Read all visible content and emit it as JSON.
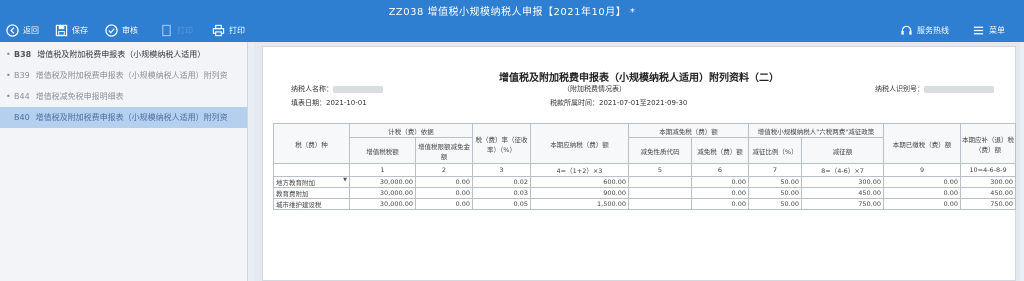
{
  "window": {
    "title": "ZZ038 增值税小规模纳税人申报【2021年10月】 *"
  },
  "toolbar": {
    "back_label": "返回",
    "save_label": "保存",
    "review_label": "审核",
    "disabled_label": "打印",
    "print_label": "打印",
    "hotline_label": "服务热线",
    "menu_label": "菜单"
  },
  "sidebar": {
    "items": [
      {
        "code": "B38",
        "label": "增值税及附加税费申报表（小规模纳税人适用）"
      },
      {
        "code": "B39",
        "label": "增值税及附加税费申报表（小规模纳税人适用）附列资"
      },
      {
        "code": "B44",
        "label": "增值税减免税申报明细表"
      },
      {
        "code": "B40",
        "label": "增值税及附加税费申报表（小规模纳税人适用）附列资"
      }
    ]
  },
  "document": {
    "title": "增值税及附加税费申报表（小规模纳税人适用）附列资料（二）",
    "subtitle": "（附加税费情况表）",
    "taxpayer_name_label": "纳税人名称：",
    "taxpayer_id_label": "纳税人识别号：",
    "fill_date": "填表日期：2021-10-01",
    "tax_period": "税款所属时间：2021-07-01至2021-09-30"
  },
  "table": {
    "h_tax_type": "税（费）种",
    "h_basis": "计税（费）依据",
    "h_rate": "税（费）率（征收率）（%）",
    "h_payable": "本期应纳税（费）额",
    "h_relief": "本期减免税（费）额",
    "h_small": "增值税小规模纳税人\"六税两费\"减征政策",
    "h_paid": "本期已缴税（费）额",
    "h_refund": "本期应补（退）税（费）额",
    "h_vat": "增值税税额",
    "h_exempt": "增值税限额减免金额",
    "h_relief_code": "减免性质代码",
    "h_relief_amt": "减免税（费）额",
    "h_ratio": "减征比例（%）",
    "h_cut_amt": "减征额",
    "idx": [
      "1",
      "2",
      "3",
      "4=（1+2）×3",
      "5",
      "6",
      "7",
      "8=（4-6）×7",
      "9",
      "10=4-6-8-9"
    ],
    "rows": [
      {
        "name": "地方教育附加",
        "c1": "30,000.00",
        "c2": "0.00",
        "c3": "0.02",
        "c4": "600.00",
        "c5": "",
        "c6": "0.00",
        "c7": "50.00",
        "c8": "300.00",
        "c9": "0.00",
        "c10": "300.00"
      },
      {
        "name": "教育费附加",
        "c1": "30,000.00",
        "c2": "0.00",
        "c3": "0.03",
        "c4": "900.00",
        "c5": "",
        "c6": "0.00",
        "c7": "50.00",
        "c8": "450.00",
        "c9": "0.00",
        "c10": "450.00"
      },
      {
        "name": "城市维护建设税",
        "c1": "30,000.00",
        "c2": "0.00",
        "c3": "0.05",
        "c4": "1,500.00",
        "c5": "",
        "c6": "0.00",
        "c7": "50.00",
        "c8": "750.00",
        "c9": "0.00",
        "c10": "750.00"
      }
    ]
  }
}
